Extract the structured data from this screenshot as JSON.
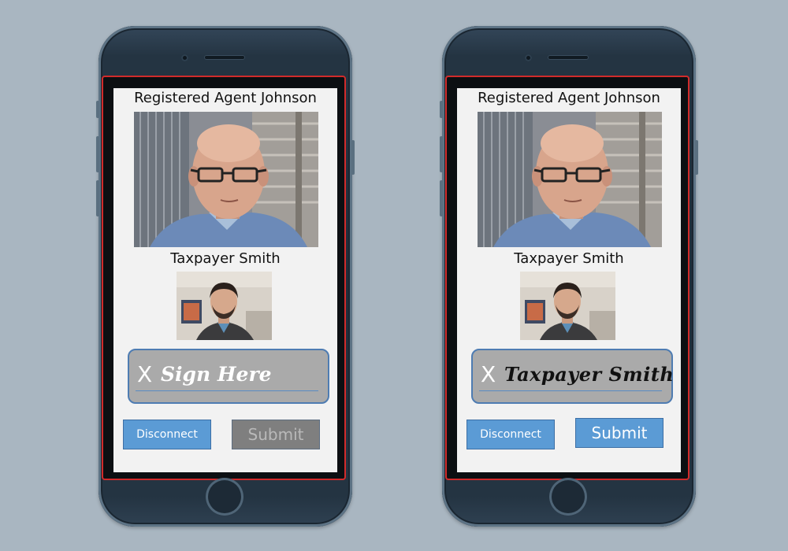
{
  "background_color": "#a9b6c1",
  "accent_color": "#5b9bd5",
  "outline_color": "#d12b2b",
  "phones": [
    {
      "state": "unsigned",
      "agent_label": "Registered Agent Johnson",
      "taxpayer_label": "Taxpayer Smith",
      "signature": {
        "x_mark": "X",
        "text": "Sign Here"
      },
      "disconnect_label": "Disconnect",
      "submit_label": "Submit",
      "submit_enabled": false
    },
    {
      "state": "signed",
      "agent_label": "Registered Agent Johnson",
      "taxpayer_label": "Taxpayer Smith",
      "signature": {
        "x_mark": "X",
        "text": "Taxpayer Smith"
      },
      "disconnect_label": "Disconnect",
      "submit_label": "Submit",
      "submit_enabled": true
    }
  ]
}
